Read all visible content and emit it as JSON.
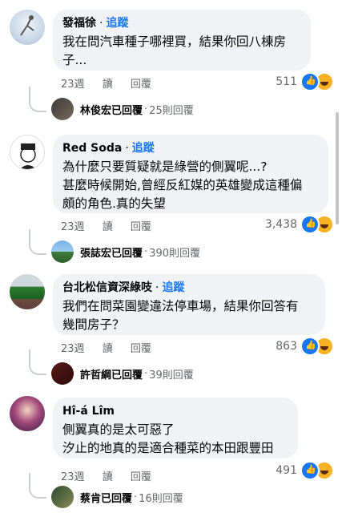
{
  "comments": [
    {
      "name": "發福徐",
      "follow": "追蹤",
      "lines": [
        "我在問汽車種子哪裡買，結果你回八棟房",
        "子..."
      ],
      "time": "23週",
      "action_read": "讀",
      "action_reply": "回覆",
      "reactions": "511",
      "reply_preview": {
        "name": "林俊宏",
        "replied": "已回覆",
        "sep": "·",
        "count": "25則回覆"
      }
    },
    {
      "name": "Red Soda",
      "follow": "追蹤",
      "lines": [
        "為什麼只要質疑就是綠營的側翼呢...?",
        "甚麼時候開始,曾經反紅媒的英雄變成這種偏",
        "頗的角色.真的失望"
      ],
      "time": "23週",
      "action_read": "讀",
      "action_reply": "回覆",
      "reactions": "3,438",
      "reply_preview": {
        "name": "張誌宏",
        "replied": "已回覆",
        "sep": "·",
        "count": "390則回覆"
      }
    },
    {
      "name": "台北松信資深綠吱",
      "follow": "追蹤",
      "lines": [
        "我們在問菜園變違法停車場，結果你回答有",
        "幾間房子？"
      ],
      "time": "23週",
      "action_read": "讀",
      "action_reply": "回覆",
      "reactions": "863",
      "reply_preview": {
        "name": "許哲綱",
        "replied": "已回覆",
        "sep": "·",
        "count": "39則回覆"
      }
    },
    {
      "name": "Hî-á Lîm",
      "follow": "",
      "lines": [
        "側翼真的是太可惡了",
        "汐止的地真的是適合種菜的本田跟豐田"
      ],
      "time": "23週",
      "action_read": "讀",
      "action_reply": "回覆",
      "reactions": "491",
      "reply_preview": {
        "name": "蔡肯",
        "replied": "已回覆",
        "sep": "·",
        "count": "16則回覆"
      }
    }
  ],
  "colors": {
    "bubble": "#f0f2f5",
    "follow": "#1877f2",
    "meta": "#65676b"
  }
}
